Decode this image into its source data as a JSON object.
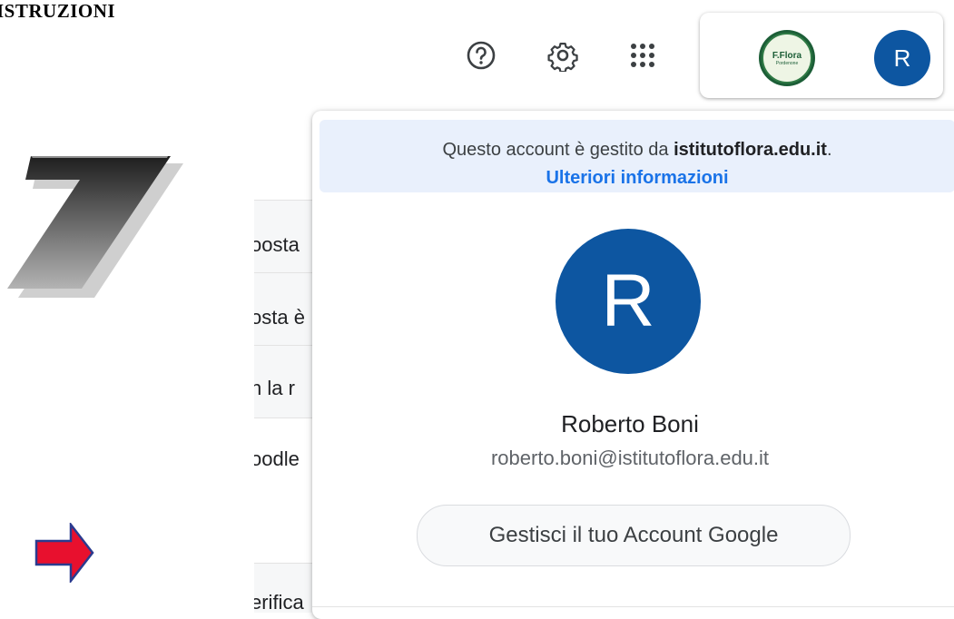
{
  "document": {
    "heading": "ISTRUZIONI",
    "step_number": "7"
  },
  "background_list": {
    "rows": [
      "oosta",
      "osta è",
      "n la r",
      "oodle",
      "",
      "erifica"
    ]
  },
  "toolbar": {
    "help_icon": "help-icon",
    "settings_icon": "gear-icon",
    "apps_icon": "apps-grid-icon",
    "org_logo_text": "F.Flora",
    "org_logo_sub": "Pordenone",
    "avatar_initial": "R"
  },
  "account_popup": {
    "managed_prefix": "Questo account è gestito da ",
    "managed_domain": "istitutoflora.edu.it",
    "managed_suffix": ".",
    "learn_more": "Ulteriori informazioni",
    "avatar_initial": "R",
    "user_name": "Roberto Boni",
    "user_email": "roberto.boni@istitutoflora.edu.it",
    "manage_button": "Gestisci il tuo Account Google"
  },
  "colors": {
    "avatar": "#0d56a1",
    "link": "#1a73e8",
    "banner": "#e9f0fc",
    "arrow": "#e8102e"
  }
}
